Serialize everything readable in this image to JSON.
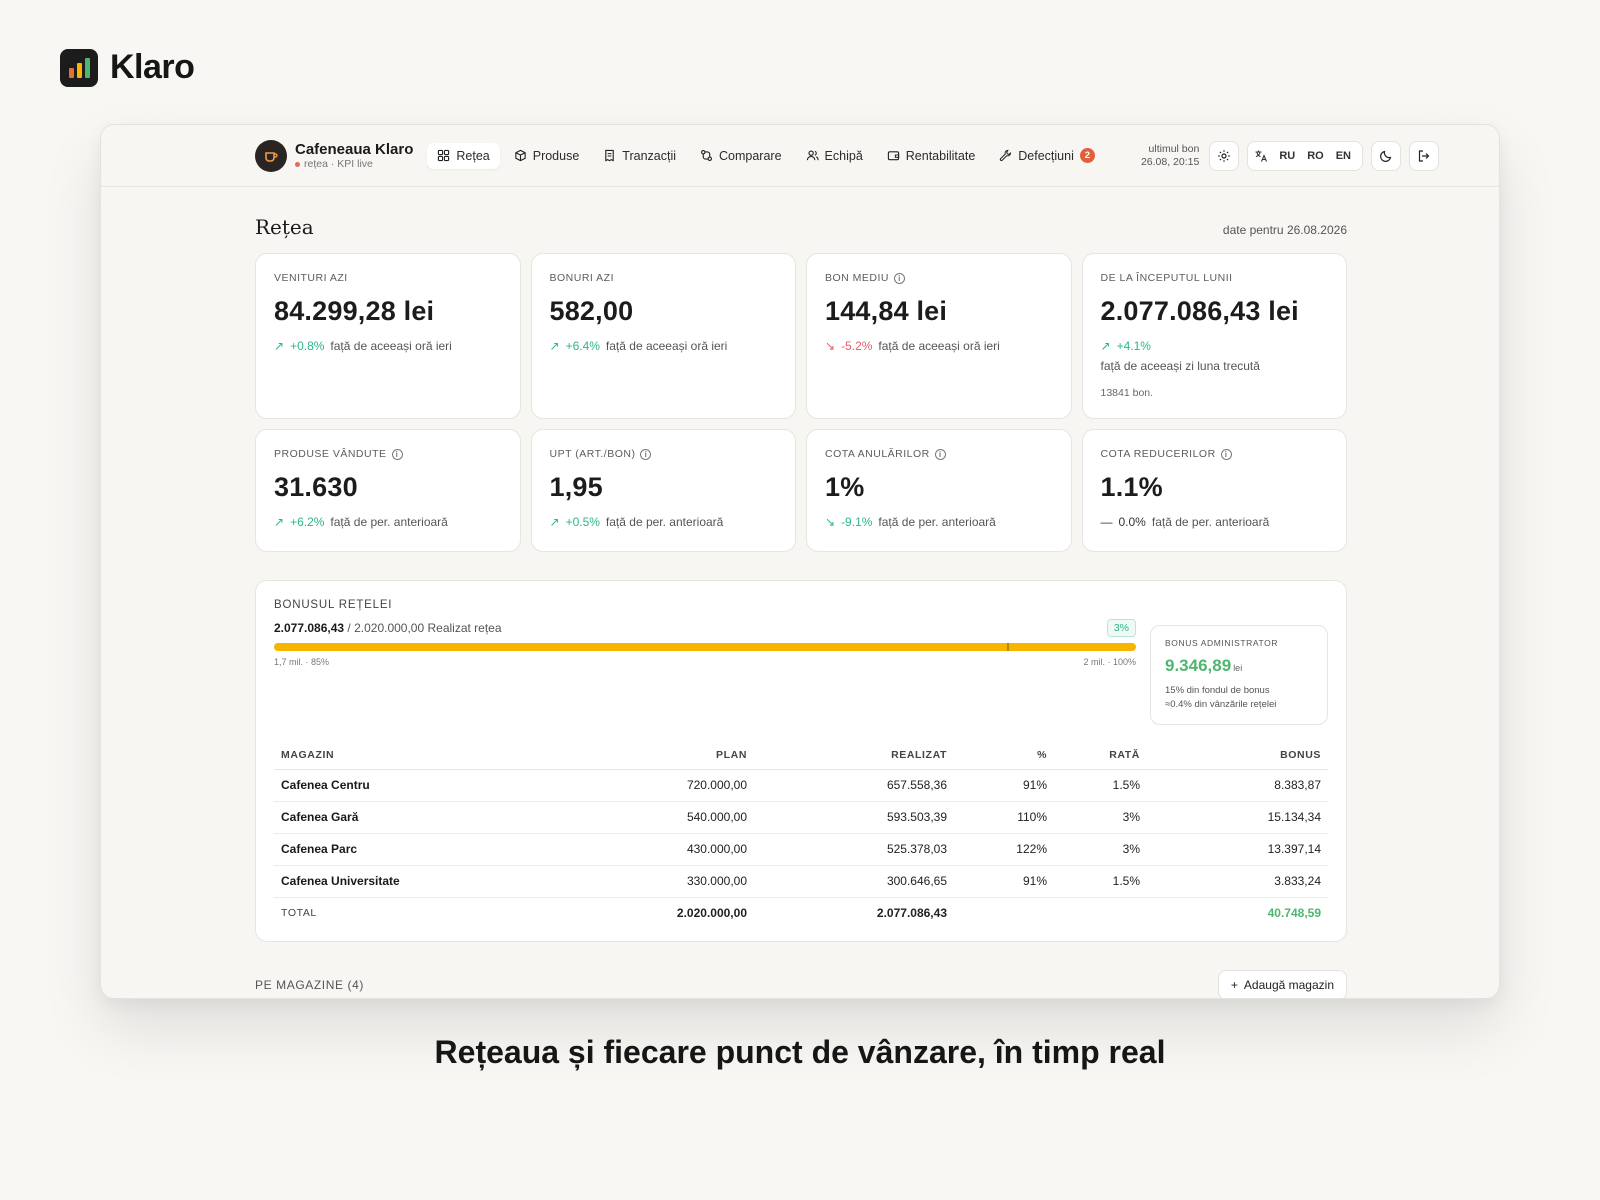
{
  "brand": {
    "name": "Klaro",
    "bar_colors": [
      "#e2703a",
      "#f7b500",
      "#4cb86f"
    ]
  },
  "topbar": {
    "store_name": "Cafeneaua Klaro",
    "store_sub": "rețea · KPI live",
    "nav": [
      {
        "label": "Rețea",
        "icon": "grid-icon",
        "active": true
      },
      {
        "label": "Produse",
        "icon": "box-icon"
      },
      {
        "label": "Tranzacții",
        "icon": "receipt-icon"
      },
      {
        "label": "Comparare",
        "icon": "compare-icon"
      },
      {
        "label": "Echipă",
        "icon": "users-icon"
      },
      {
        "label": "Rentabilitate",
        "icon": "wallet-icon"
      },
      {
        "label": "Defecțiuni",
        "icon": "wrench-icon",
        "badge": "2"
      }
    ],
    "last_bon_label": "ultimul bon",
    "last_bon_time": "26.08, 20:15",
    "languages": [
      "RU",
      "RO",
      "EN"
    ]
  },
  "page": {
    "title": "Rețea",
    "date": "date pentru 26.08.2026"
  },
  "kpis_top": [
    {
      "label": "VENITURI AZI",
      "value": "84.299,28 lei",
      "delta": "+0.8%",
      "trend": "up",
      "note": "față de aceeași oră ieri"
    },
    {
      "label": "BONURI AZI",
      "value": "582,00",
      "delta": "+6.4%",
      "trend": "up",
      "note": "față de aceeași oră ieri"
    },
    {
      "label": "BON MEDIU",
      "value": "144,84 lei",
      "delta": "-5.2%",
      "trend": "down",
      "note": "față de aceeași oră ieri",
      "info": true
    },
    {
      "label": "DE LA ÎNCEPUTUL LUNII",
      "value": "2.077.086,43 lei",
      "delta": "+4.1%",
      "trend": "up",
      "note": "față de aceeași zi luna trecută",
      "extra": "13841 bon."
    }
  ],
  "kpis_bottom": [
    {
      "label": "PRODUSE VÂNDUTE",
      "value": "31.630",
      "delta": "+6.2%",
      "trend": "up",
      "note": "față de per. anterioară"
    },
    {
      "label": "UPT (ART./BON)",
      "value": "1,95",
      "delta": "+0.5%",
      "trend": "up",
      "note": "față de per. anterioară"
    },
    {
      "label": "COTA ANULĂRILOR",
      "value": "1%",
      "delta": "-9.1%",
      "trend": "down-good",
      "note": "față de per. anterioară"
    },
    {
      "label": "COTA REDUCERILOR",
      "value": "1.1%",
      "delta": "0.0%",
      "trend": "flat",
      "note": "față de per. anterioară"
    }
  ],
  "bonus": {
    "title": "BONUSUL REȚELEI",
    "achieved": "2.077.086,43",
    "target_text": "/ 2.020.000,00 Realizat rețea",
    "pct_badge": "3%",
    "progress_fraction": 1.0,
    "marker_fraction": 0.85,
    "tick_left": "1,7 mil. · 85%",
    "tick_right": "2 mil. · 100%",
    "admin_label": "BONUS ADMINISTRATOR",
    "admin_value": "9.346,89",
    "admin_unit": "lei",
    "admin_note_1": "15% din fondul de bonus",
    "admin_note_2": "≈0.4% din vânzările rețelei"
  },
  "table": {
    "headers": [
      "MAGAZIN",
      "PLAN",
      "REALIZAT",
      "%",
      "RATĂ",
      "BONUS"
    ],
    "rows": [
      [
        "Cafenea Centru",
        "720.000,00",
        "657.558,36",
        "91%",
        "1.5%",
        "8.383,87"
      ],
      [
        "Cafenea Gară",
        "540.000,00",
        "593.503,39",
        "110%",
        "3%",
        "15.134,34"
      ],
      [
        "Cafenea Parc",
        "430.000,00",
        "525.378,03",
        "122%",
        "3%",
        "13.397,14"
      ],
      [
        "Cafenea Universitate",
        "330.000,00",
        "300.646,65",
        "91%",
        "1.5%",
        "3.833,24"
      ]
    ],
    "total": [
      "TOTAL",
      "2.020.000,00",
      "2.077.086,43",
      "",
      "",
      "40.748,59"
    ]
  },
  "section": {
    "label": "PE MAGAZINE (4)",
    "add_button": "Adaugă magazin"
  },
  "caption": "Rețeaua și fiecare punct de vânzare, în timp real",
  "colors": {
    "accent_up": "#2bb58f",
    "accent_down": "#e25d6e",
    "progress": "#f7b500",
    "bonus_green": "#4cb86f"
  }
}
